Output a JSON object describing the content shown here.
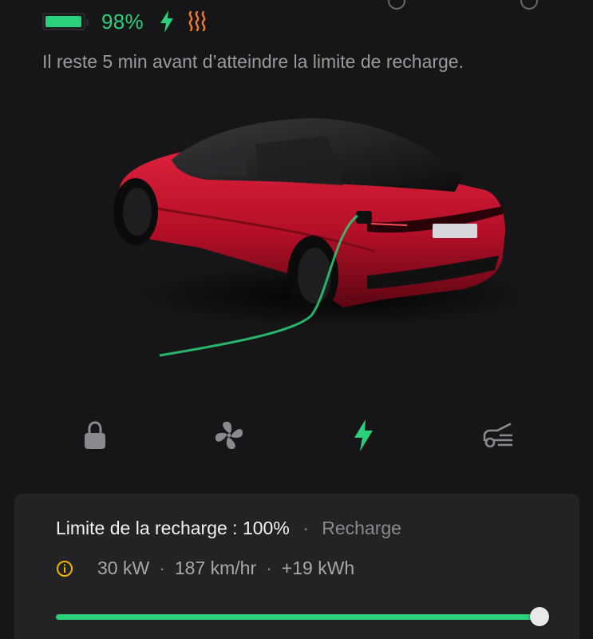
{
  "status": {
    "battery_level": 0.98,
    "battery_percent_text": "98%",
    "charging_icon": "bolt-icon",
    "heater_icon": "seat-heater-icon",
    "message": "Il reste 5 min avant d’atteindre la limite de recharge."
  },
  "nav": {
    "items": [
      {
        "icon": "lock-icon",
        "active": false
      },
      {
        "icon": "fan-icon",
        "active": false
      },
      {
        "icon": "bolt-icon",
        "active": true
      },
      {
        "icon": "car-trunk-icon",
        "active": false
      }
    ]
  },
  "charge_card": {
    "limit_label": "Limite de la recharge :",
    "limit_value": "100%",
    "separator": "·",
    "state": "Recharge",
    "power": "30 kW",
    "rate": "187 km/hr",
    "energy_added": "+19 kWh",
    "limit_fraction": 1.0
  },
  "colors": {
    "accent": "#2bd07a",
    "heater": "#f07a2a",
    "car": "#c8102e"
  }
}
